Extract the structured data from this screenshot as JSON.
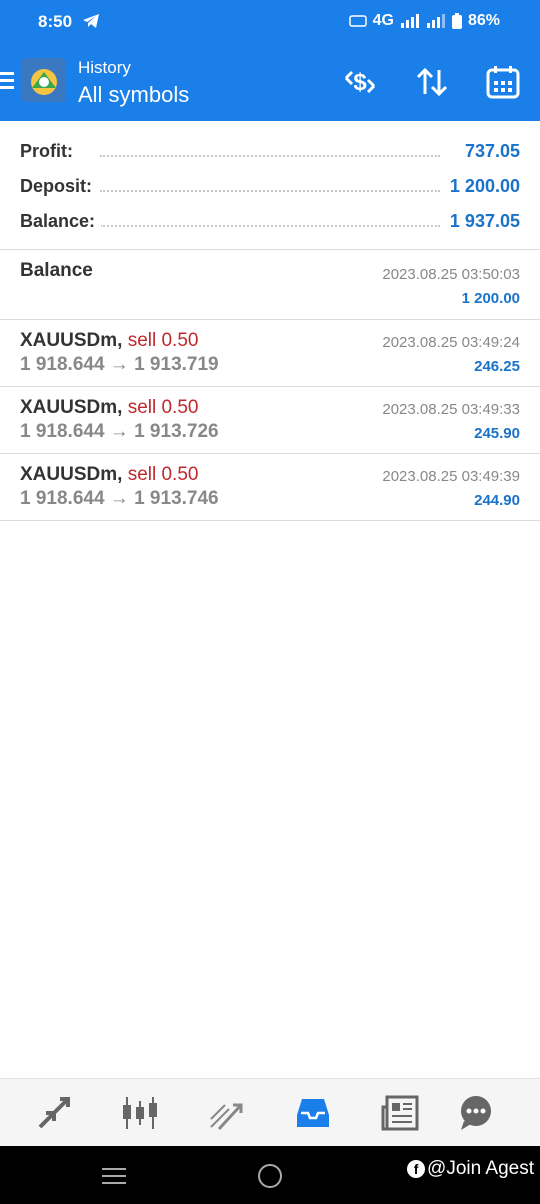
{
  "status": {
    "time": "8:50",
    "network": "4G",
    "battery": "86%"
  },
  "header": {
    "subtitle": "History",
    "title": "All symbols"
  },
  "summary": [
    {
      "label": "Profit:",
      "value": "737.05"
    },
    {
      "label": "Deposit:",
      "value": "1 200.00"
    },
    {
      "label": "Balance:",
      "value": "1 937.05"
    }
  ],
  "balance_entry": {
    "label": "Balance",
    "date": "2023.08.25 03:50:03",
    "amount": "1 200.00"
  },
  "trades": [
    {
      "symbol": "XAUUSDm,",
      "side": "sell 0.50",
      "prices": "1 918.644 → 1 913.719",
      "date": "2023.08.25 03:49:24",
      "profit": "246.25"
    },
    {
      "symbol": "XAUUSDm,",
      "side": "sell 0.50",
      "prices": "1 918.644 → 1 913.726",
      "date": "2023.08.25 03:49:33",
      "profit": "245.90"
    },
    {
      "symbol": "XAUUSDm,",
      "side": "sell 0.50",
      "prices": "1 918.644 → 1 913.746",
      "date": "2023.08.25 03:49:39",
      "profit": "244.90"
    }
  ],
  "watermark": "@Join Agest",
  "colors": {
    "primary": "#1a7fe8",
    "profit": "#1a73c9",
    "sell": "#c0282d"
  }
}
